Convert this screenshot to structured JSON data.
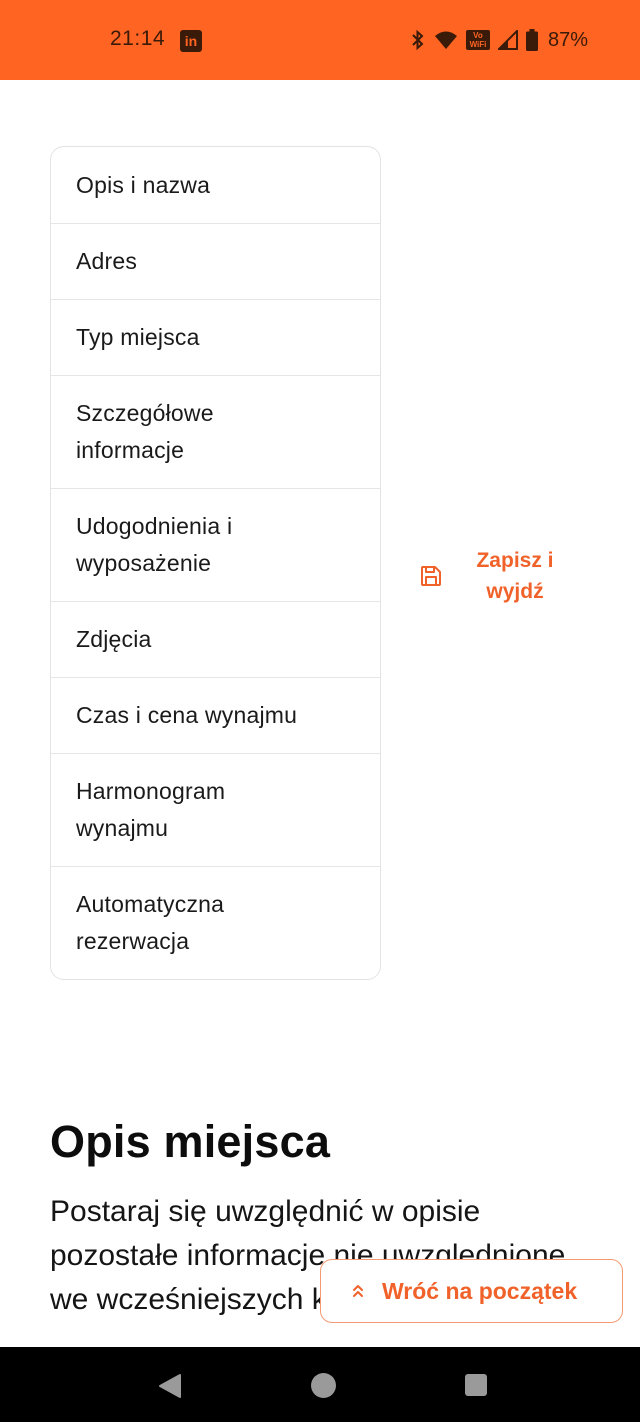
{
  "status_bar": {
    "time": "21:14",
    "notification_icons": [
      "linkedin-icon"
    ],
    "system_icons": [
      "bluetooth-icon",
      "wifi-icon",
      "vowifi-icon",
      "signal-icon",
      "battery-icon"
    ],
    "vowifi_text_top": "Vo",
    "vowifi_text_bottom": "WiFi",
    "battery_percent": "87%",
    "background_color": "#ff6422"
  },
  "steps_menu": {
    "items": [
      {
        "label": "Opis i nazwa"
      },
      {
        "label": "Adres"
      },
      {
        "label": "Typ miejsca"
      },
      {
        "label": "Szczegółowe informacje"
      },
      {
        "label": "Udogodnienia i wyposażenie"
      },
      {
        "label": "Zdjęcia"
      },
      {
        "label": "Czas i cena wynajmu"
      },
      {
        "label": "Harmonogram wynajmu"
      },
      {
        "label": "Automatyczna rezerwacja"
      }
    ]
  },
  "save_exit": {
    "icon": "floppy-disk-icon",
    "label": "Zapisz i wyjdź"
  },
  "section": {
    "title": "Opis miejsca",
    "body": "Postaraj się uwzględnić w opisie pozostałe informacje nie uwzględnione we wcześniejszych krokach"
  },
  "back_to_top": {
    "icon": "double-chevron-up-icon",
    "label": "Wróć na początek"
  },
  "theme": {
    "accent": "#f0622a",
    "border": "#e3e3e3"
  }
}
